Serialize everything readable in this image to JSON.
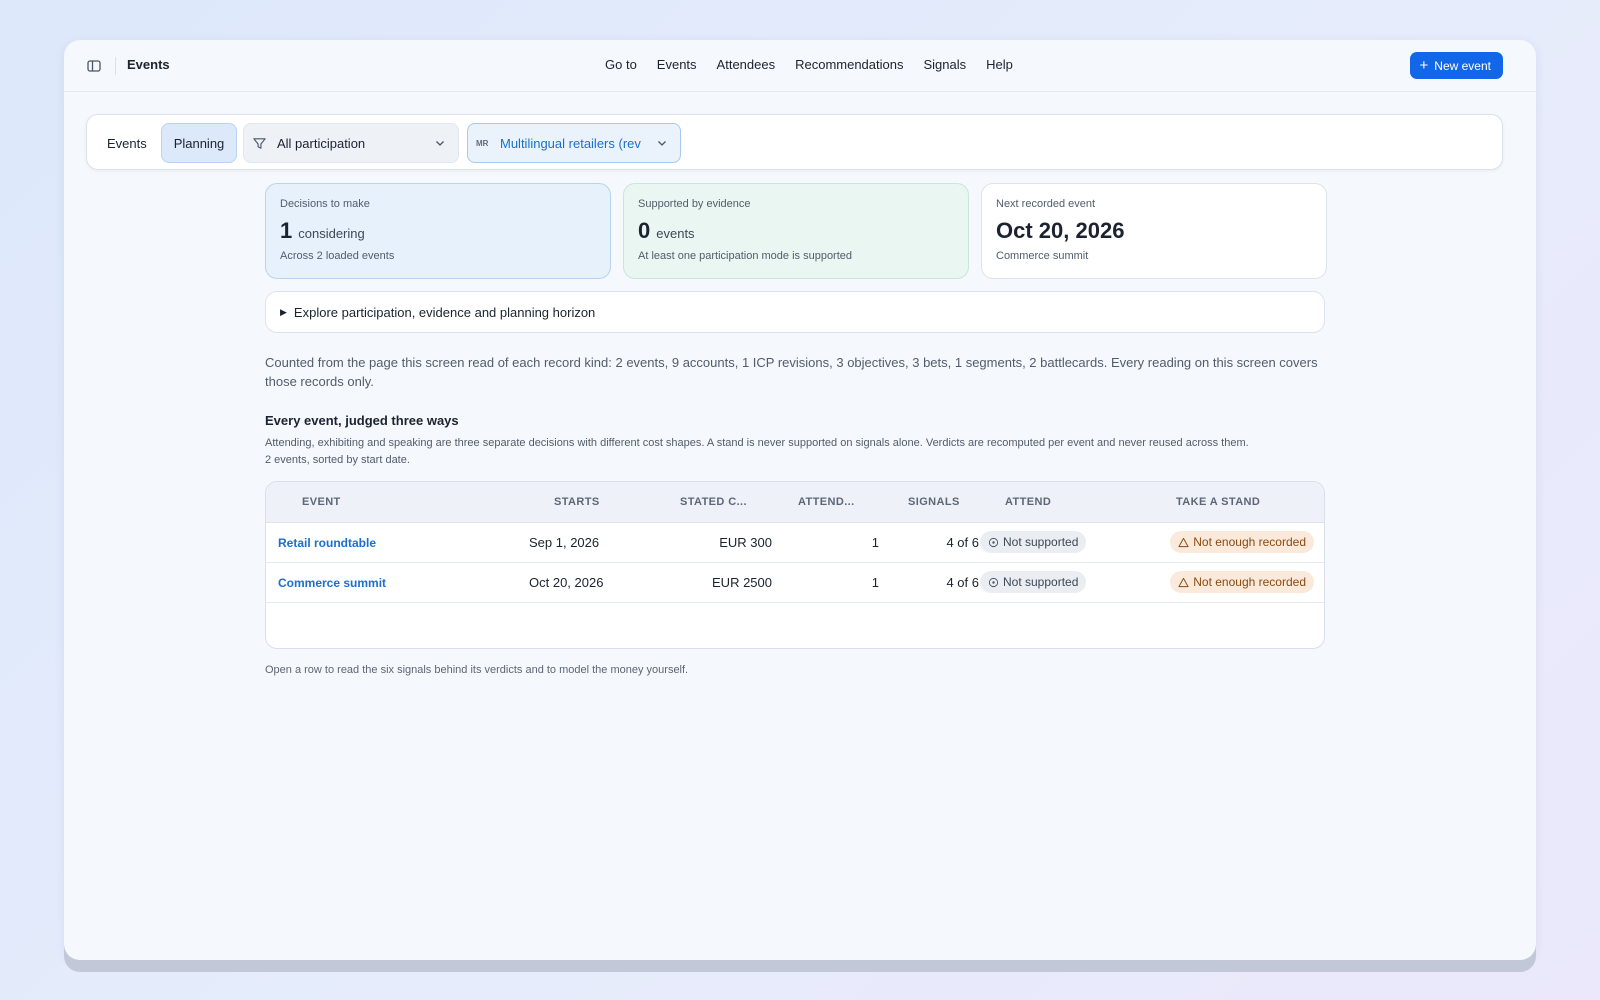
{
  "header": {
    "title": "Events",
    "nav": [
      "Go to",
      "Events",
      "Attendees",
      "Recommendations",
      "Signals",
      "Help"
    ],
    "new_event_label": "New event",
    "accent": "#1167e8"
  },
  "filters": {
    "tab_events": "Events",
    "tab_planning": "Planning",
    "participation_value": "All participation",
    "segment_initials": "MR",
    "segment_value": "Multilingual retailers (rev"
  },
  "cards": [
    {
      "label": "Decisions to make",
      "value": "1",
      "unit": "considering",
      "sub": "Across 2 loaded events"
    },
    {
      "label": "Supported by evidence",
      "value": "0",
      "unit": "events",
      "sub": "At least one participation mode is supported"
    },
    {
      "label": "Next recorded event",
      "value": "Oct 20, 2026",
      "unit": "",
      "sub": "Commerce summit"
    }
  ],
  "explore_label": "Explore participation, evidence and planning horizon",
  "counted_text": "Counted from the page this screen read of each record kind: 2 events, 9 accounts, 1 ICP revisions, 3 objectives, 3 bets, 1 segments, 2 battlecards. Every reading on this screen covers those records only.",
  "section": {
    "title": "Every event, judged three ways",
    "description": "Attending, exhibiting and speaking are three separate decisions with different cost shapes. A stand is never supported on signals alone. Verdicts are recomputed per event and never reused across them.",
    "count_text": "2 events, sorted by start date."
  },
  "table": {
    "headers": [
      "EVENT",
      "STARTS",
      "STATED C...",
      "ATTEND...",
      "SIGNALS",
      "ATTEND",
      "TAKE A STAND"
    ],
    "rows": [
      {
        "event": "Retail roundtable",
        "starts": "Sep 1, 2026",
        "cost": "EUR 300",
        "attendees": "1",
        "signals": "4 of 6",
        "attend": "Not supported",
        "stand": "Not enough recorded"
      },
      {
        "event": "Commerce summit",
        "starts": "Oct 20, 2026",
        "cost": "EUR 2500",
        "attendees": "1",
        "signals": "4 of 6",
        "attend": "Not supported",
        "stand": "Not enough recorded"
      }
    ]
  },
  "footnote": "Open a row to read the six signals behind its verdicts and to model the money yourself."
}
